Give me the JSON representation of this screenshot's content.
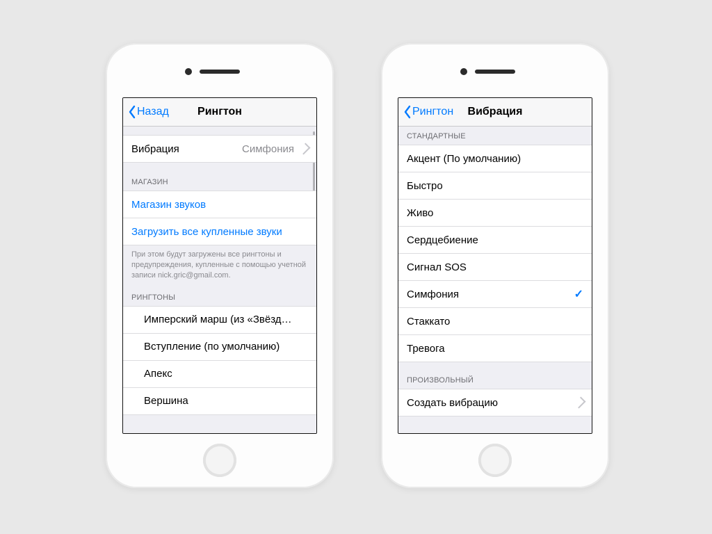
{
  "colors": {
    "tint": "#007aff",
    "groupedBg": "#efeff4",
    "secondary": "#8a8a8f"
  },
  "left": {
    "back": "Назад",
    "title": "Рингтон",
    "vibration": {
      "label": "Вибрация",
      "value": "Симфония"
    },
    "storeHeader": "МАГАЗИН",
    "storeItems": [
      "Магазин звуков",
      "Загрузить все купленные звуки"
    ],
    "storeFooter": "При этом будут загружены все рингтоны и предупреждения, купленные с помощью учетной записи nick.gric@gmail.com.",
    "ringtonesHeader": "РИНГТОНЫ",
    "ringtones": [
      "Имперский марш (из «Звёзд…",
      "Вступление (по умолчанию)",
      "Апекс",
      "Вершина"
    ]
  },
  "right": {
    "back": "Рингтон",
    "title": "Вибрация",
    "standardHeader": "СТАНДАРТНЫЕ",
    "patterns": [
      {
        "label": "Акцент (По умолчанию)",
        "selected": false
      },
      {
        "label": "Быстро",
        "selected": false
      },
      {
        "label": "Живо",
        "selected": false
      },
      {
        "label": "Сердцебиение",
        "selected": false
      },
      {
        "label": "Сигнал SOS",
        "selected": false
      },
      {
        "label": "Симфония",
        "selected": true
      },
      {
        "label": "Стаккато",
        "selected": false
      },
      {
        "label": "Тревога",
        "selected": false
      }
    ],
    "customHeader": "ПРОИЗВОЛЬНЫЙ",
    "create": "Создать вибрацию"
  }
}
